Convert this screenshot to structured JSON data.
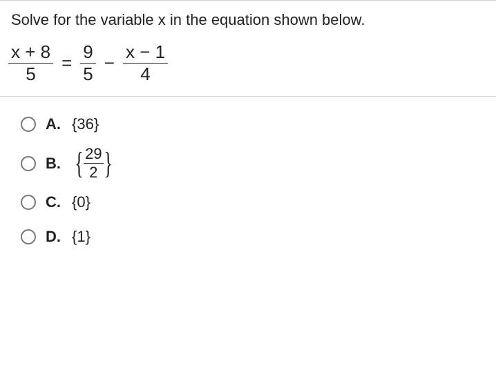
{
  "question": {
    "prompt": "Solve for the variable x in the equation shown below.",
    "equation": {
      "lhs": {
        "numerator": "x + 8",
        "denominator": "5"
      },
      "eq": "=",
      "r1": {
        "numerator": "9",
        "denominator": "5"
      },
      "minus": "−",
      "r2": {
        "numerator": "x − 1",
        "denominator": "4"
      }
    }
  },
  "choices": {
    "a": {
      "letter": "A.",
      "text": "{36}"
    },
    "b": {
      "letter": "B.",
      "frac": {
        "num": "29",
        "den": "2"
      }
    },
    "c": {
      "letter": "C.",
      "text": "{0}"
    },
    "d": {
      "letter": "D.",
      "text": "{1}"
    }
  }
}
